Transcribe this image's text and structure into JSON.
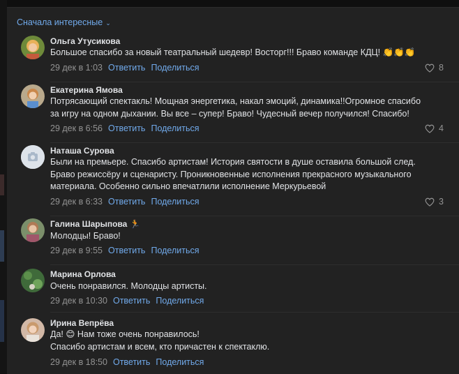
{
  "sort_label": "Сначала интересные",
  "actions": {
    "reply": "Ответить",
    "share": "Поделиться"
  },
  "comments": [
    {
      "author": "Ольга Утусикова",
      "lines": [
        "Большое спасибо за новый театральный шедевр! Восторг!!! Браво команде КДЦ! 👏👏👏"
      ],
      "date": "29 дек в 1:03",
      "likes": "8"
    },
    {
      "author": "Екатерина Ямова",
      "lines": [
        "Потрясающий спектакль! Мощная энергетика, накал эмоций, динамика!!Огромное спасибо",
        "за игру на одном дыхании. Вы все – супер! Браво! Чудесный вечер получился! Спасибо!"
      ],
      "date": "29 дек в 6:56",
      "likes": "4"
    },
    {
      "author": "Наташа Сурова",
      "lines": [
        "Были на премьере. Спасибо артистам! История святости в душе оставила большой след.",
        "Браво режиссёру и сценаристу. Проникновенные исполнения прекрасного музыкального",
        "материала. Особенно сильно впечатлили исполнение Меркурьевой"
      ],
      "date": "29 дек в 6:33",
      "likes": "3"
    },
    {
      "author": "Галина Шарыпова",
      "badge": "🏃",
      "lines": [
        "Молодцы! Браво!"
      ],
      "date": "29 дек в 9:55",
      "likes": ""
    },
    {
      "author": "Марина Орлова",
      "lines": [
        "Очень понравился. Молодцы артисты."
      ],
      "date": "29 дек в 10:30",
      "likes": ""
    },
    {
      "author": "Ирина Вепрёва",
      "lines": [
        "Да! 😊 Нам тоже очень понравилось!",
        "Спасибо артистам и всем, кто причастен к спектаклю."
      ],
      "date": "29 дек в 18:50",
      "likes": ""
    }
  ],
  "colors": {
    "background": "#222222",
    "link": "#71aaeb",
    "meta": "#939393",
    "text": "#e1e3e6"
  },
  "icons": [
    "heart-icon",
    "camera-icon",
    "chevron-down-icon",
    "runner-icon"
  ]
}
